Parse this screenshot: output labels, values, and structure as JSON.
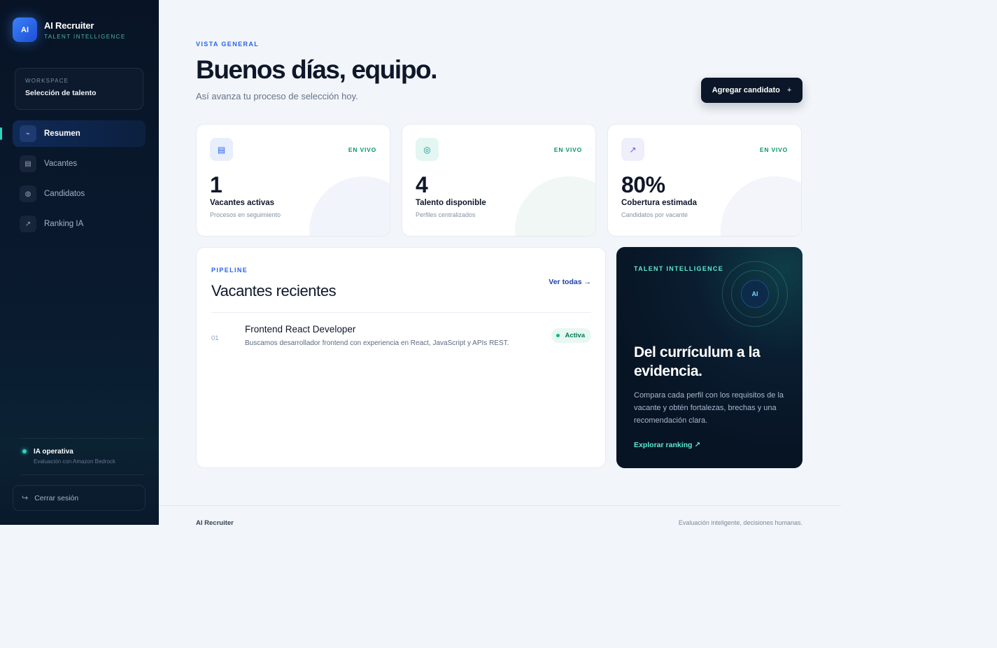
{
  "sidebar": {
    "brand": {
      "logo_text": "AI",
      "name": "AI Recruiter",
      "tagline": "TALENT INTELLIGENCE"
    },
    "workspace": {
      "label": "WORKSPACE",
      "value": "Selección de talento"
    },
    "nav": [
      {
        "label": "Resumen",
        "icon": "pulse-icon",
        "glyph": "⌁",
        "active": true
      },
      {
        "label": "Vacantes",
        "icon": "list-icon",
        "glyph": "▤",
        "active": false
      },
      {
        "label": "Candidatos",
        "icon": "globe-icon",
        "glyph": "◍",
        "active": false
      },
      {
        "label": "Ranking IA",
        "icon": "trend-arrow-icon",
        "glyph": "↗",
        "active": false
      }
    ],
    "status": {
      "title": "IA operativa",
      "subtitle": "Evaluación con Amazon Bedrock"
    },
    "logout": {
      "icon_glyph": "↪",
      "label": "Cerrar sesión"
    }
  },
  "header": {
    "eyebrow": "VISTA GENERAL",
    "title": "Buenos días, equipo.",
    "subtitle": "Así avanza tu proceso de selección hoy.",
    "add_button": {
      "label": "Agregar candidato",
      "icon_glyph": "+"
    }
  },
  "stats": [
    {
      "icon": "list-icon",
      "glyph": "▤",
      "icon_bg": "#e8effc",
      "icon_color": "#2563eb",
      "live": "EN VIVO",
      "value": "1",
      "label": "Vacantes activas",
      "sub": "Procesos en seguimiento"
    },
    {
      "icon": "target-icon",
      "glyph": "◎",
      "icon_bg": "#e3f6f2",
      "icon_color": "#0d9488",
      "live": "EN VIVO",
      "value": "4",
      "label": "Talento disponible",
      "sub": "Perfiles centralizados"
    },
    {
      "icon": "trend-arrow-icon",
      "glyph": "↗",
      "icon_bg": "#efeefb",
      "icon_color": "#6d5dd3",
      "live": "EN VIVO",
      "value": "80%",
      "label": "Cobertura estimada",
      "sub": "Candidatos por vacante"
    }
  ],
  "pipeline": {
    "eyebrow": "PIPELINE",
    "title": "Vacantes recientes",
    "link": "Ver todas →",
    "rows": [
      {
        "num": "01",
        "title": "Frontend React Developer",
        "desc": "Buscamos desarrollador frontend con experiencia en React, JavaScript y APIs REST.",
        "badge": "Activa"
      }
    ]
  },
  "talent": {
    "eyebrow": "TALENT INTELLIGENCE",
    "badge": "AI",
    "title": "Del currículum a la evidencia.",
    "text": "Compara cada perfil con los requisitos de la vacante y obtén fortalezas, brechas y una recomendación clara.",
    "link": "Explorar ranking ↗"
  },
  "footer": {
    "brand": "AI Recruiter",
    "tagline": "Evaluación inteligente, decisiones humanas."
  }
}
